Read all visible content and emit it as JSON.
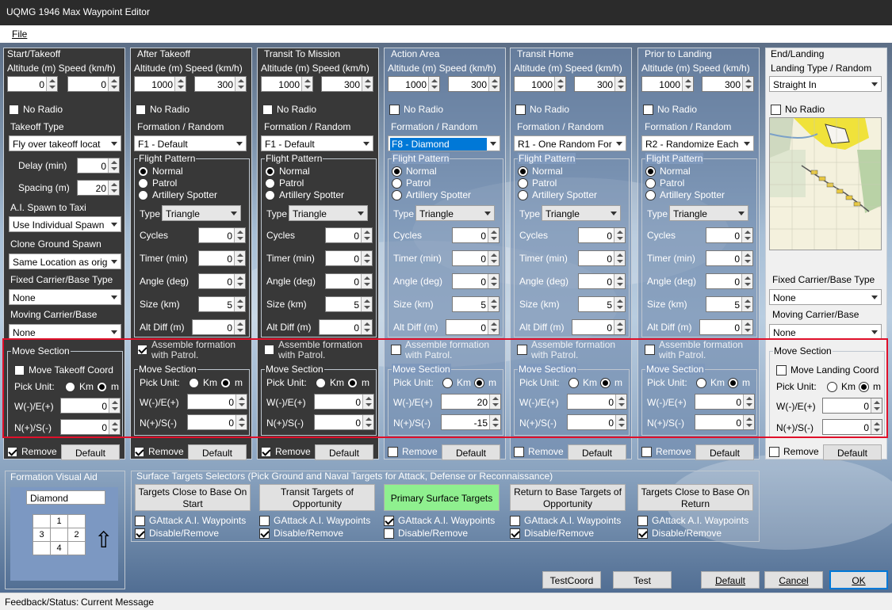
{
  "window": {
    "title": "UQMG 1946 Max Waypoint Editor"
  },
  "menu": {
    "file": "File"
  },
  "common": {
    "alt_speed": "Altitude (m) Speed (km/h)",
    "no_radio": "No Radio",
    "formation": "Formation / Random",
    "flight_pattern": "Flight Pattern",
    "normal": "Normal",
    "patrol": "Patrol",
    "artillery": "Artillery Spotter",
    "type": "Type",
    "cycles": "Cycles",
    "timer": "Timer (min)",
    "angle": "Angle (deg)",
    "size": "Size (km)",
    "alt_diff": "Alt Diff (m)",
    "assemble": "Assemble formation with Patrol.",
    "move_section": "Move Section",
    "pick_unit": "Pick Unit:",
    "km": "Km",
    "m": "m",
    "we": "W(-)/E(+)",
    "ns": "N(+)/S(-)",
    "remove": "Remove",
    "default": "Default"
  },
  "takeoff": {
    "title": "Start/Takeoff",
    "alt": "0",
    "speed": "0",
    "takeoff_type_label": "Takeoff Type",
    "takeoff_type": "Fly over takeoff locat",
    "delay_label": "Delay (min)",
    "delay": "0",
    "spacing_label": "Spacing (m)",
    "spacing": "20",
    "ai_spawn_label": "A.I. Spawn to Taxi",
    "ai_spawn": "Use Individual Spawn",
    "clone_label": "Clone Ground Spawn",
    "clone": "Same Location as orig",
    "fixed_label": "Fixed Carrier/Base Type",
    "fixed": "None",
    "moving_label": "Moving Carrier/Base",
    "moving": "None",
    "move_coord": "Move Takeoff Coord",
    "we": "0",
    "ns": "0"
  },
  "panels": [
    {
      "title": "After Takeoff",
      "alt": "1000",
      "speed": "300",
      "formation": "F1 - Default",
      "pattern": "Triangle",
      "cycles": "0",
      "timer": "0",
      "angle": "0",
      "size": "5",
      "altdiff": "0",
      "we": "0",
      "ns": "0"
    },
    {
      "title": "Transit To Mission",
      "alt": "1000",
      "speed": "300",
      "formation": "F1 - Default",
      "pattern": "Triangle",
      "cycles": "0",
      "timer": "0",
      "angle": "0",
      "size": "5",
      "altdiff": "0",
      "we": "0",
      "ns": "0"
    },
    {
      "title": "Action Area",
      "alt": "1000",
      "speed": "300",
      "formation": "F8 - Diamond",
      "pattern": "Triangle",
      "cycles": "0",
      "timer": "0",
      "angle": "0",
      "size": "5",
      "altdiff": "0",
      "we": "20",
      "ns": "-15"
    },
    {
      "title": "Transit Home",
      "alt": "1000",
      "speed": "300",
      "formation": "R1 - One Random For",
      "pattern": "Triangle",
      "cycles": "0",
      "timer": "0",
      "angle": "0",
      "size": "5",
      "altdiff": "0",
      "we": "0",
      "ns": "0"
    },
    {
      "title": "Prior to Landing",
      "alt": "1000",
      "speed": "300",
      "formation": "R2 - Randomize Each",
      "pattern": "Triangle",
      "cycles": "0",
      "timer": "0",
      "angle": "0",
      "size": "5",
      "altdiff": "0",
      "we": "0",
      "ns": "0"
    }
  ],
  "landing": {
    "title": "End/Landing",
    "type_label": "Landing Type / Random",
    "type": "Straight In",
    "fixed_label": "Fixed Carrier/Base Type",
    "fixed": "None",
    "moving_label": "Moving Carrier/Base",
    "moving": "None",
    "move_coord": "Move Landing Coord",
    "we": "0",
    "ns": "0"
  },
  "aid": {
    "title": "Formation Visual Aid",
    "name": "Diamond",
    "c1": "1",
    "c2": "2",
    "c3": "3",
    "c4": "4",
    "arrow": "⇧"
  },
  "targets": {
    "title": "Surface Targets Selectors (Pick Ground and Naval Targets for Attack, Defense or Reconnaissance)",
    "gattack": "GAttack A.I. Waypoints",
    "disable": "Disable/Remove",
    "buttons": [
      "Targets Close to Base On Start",
      "Transit Targets of Opportunity",
      "Primary Surface Targets",
      "Return to Base Targets of Opportunity",
      "Targets Close to Base On Return"
    ]
  },
  "footer": {
    "testcoord": "TestCoord",
    "test": "Test",
    "default": "Default",
    "cancel": "Cancel",
    "ok": "OK"
  },
  "status": {
    "label": "Feedback/Status:",
    "message": "Current Message"
  },
  "colors": {
    "accent": "#0078d7",
    "highlight": "#e0102a",
    "primary_target": "#8ff08f"
  }
}
